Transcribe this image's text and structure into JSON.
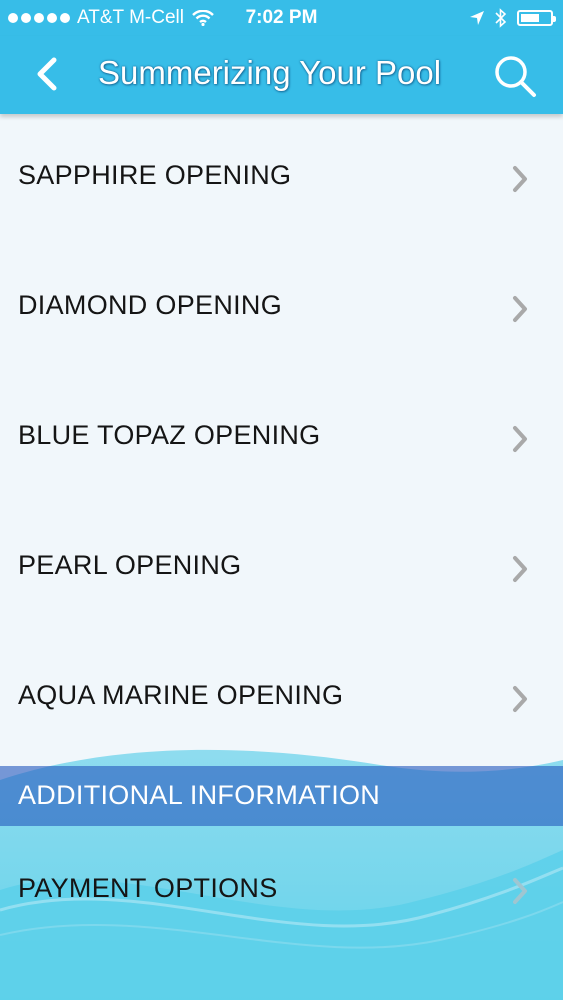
{
  "status_bar": {
    "carrier": "AT&T M-Cell",
    "time": "7:02 PM",
    "signal_dots_filled": 5,
    "icons": [
      "wifi-icon",
      "location-arrow-icon",
      "bluetooth-icon",
      "battery-icon"
    ]
  },
  "nav": {
    "title": "Summerizing Your Pool",
    "back_icon": "chevron-left-icon",
    "search_icon": "search-icon"
  },
  "items": [
    {
      "label": "SAPPHIRE OPENING"
    },
    {
      "label": "DIAMOND OPENING"
    },
    {
      "label": "BLUE TOPAZ OPENING"
    },
    {
      "label": "PEARL OPENING"
    },
    {
      "label": "AQUA MARINE OPENING"
    }
  ],
  "section": {
    "header": "ADDITIONAL INFORMATION",
    "items": [
      {
        "label": "PAYMENT OPTIONS"
      }
    ]
  },
  "colors": {
    "nav_bar": "#37bde8",
    "list_background": "#f1f7fb",
    "section_header": "#285cbe",
    "water_background": "#5fd3ea",
    "chevron": "#a9a9a9"
  }
}
